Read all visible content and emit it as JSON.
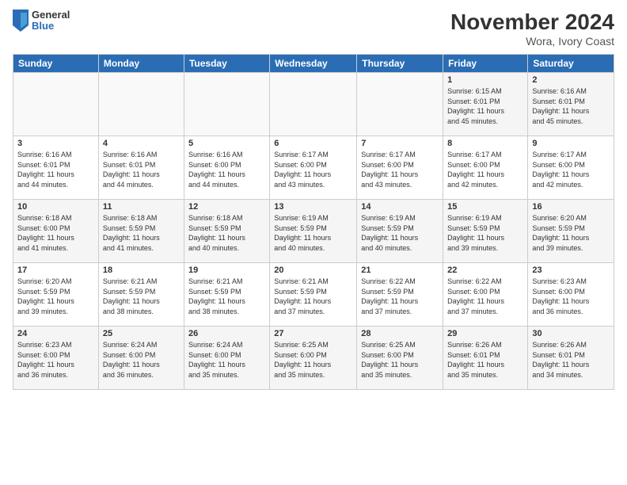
{
  "logo": {
    "general": "General",
    "blue": "Blue"
  },
  "title": "November 2024",
  "subtitle": "Wora, Ivory Coast",
  "days_of_week": [
    "Sunday",
    "Monday",
    "Tuesday",
    "Wednesday",
    "Thursday",
    "Friday",
    "Saturday"
  ],
  "weeks": [
    [
      {
        "day": "",
        "info": ""
      },
      {
        "day": "",
        "info": ""
      },
      {
        "day": "",
        "info": ""
      },
      {
        "day": "",
        "info": ""
      },
      {
        "day": "",
        "info": ""
      },
      {
        "day": "1",
        "info": "Sunrise: 6:15 AM\nSunset: 6:01 PM\nDaylight: 11 hours\nand 45 minutes."
      },
      {
        "day": "2",
        "info": "Sunrise: 6:16 AM\nSunset: 6:01 PM\nDaylight: 11 hours\nand 45 minutes."
      }
    ],
    [
      {
        "day": "3",
        "info": "Sunrise: 6:16 AM\nSunset: 6:01 PM\nDaylight: 11 hours\nand 44 minutes."
      },
      {
        "day": "4",
        "info": "Sunrise: 6:16 AM\nSunset: 6:01 PM\nDaylight: 11 hours\nand 44 minutes."
      },
      {
        "day": "5",
        "info": "Sunrise: 6:16 AM\nSunset: 6:00 PM\nDaylight: 11 hours\nand 44 minutes."
      },
      {
        "day": "6",
        "info": "Sunrise: 6:17 AM\nSunset: 6:00 PM\nDaylight: 11 hours\nand 43 minutes."
      },
      {
        "day": "7",
        "info": "Sunrise: 6:17 AM\nSunset: 6:00 PM\nDaylight: 11 hours\nand 43 minutes."
      },
      {
        "day": "8",
        "info": "Sunrise: 6:17 AM\nSunset: 6:00 PM\nDaylight: 11 hours\nand 42 minutes."
      },
      {
        "day": "9",
        "info": "Sunrise: 6:17 AM\nSunset: 6:00 PM\nDaylight: 11 hours\nand 42 minutes."
      }
    ],
    [
      {
        "day": "10",
        "info": "Sunrise: 6:18 AM\nSunset: 6:00 PM\nDaylight: 11 hours\nand 41 minutes."
      },
      {
        "day": "11",
        "info": "Sunrise: 6:18 AM\nSunset: 5:59 PM\nDaylight: 11 hours\nand 41 minutes."
      },
      {
        "day": "12",
        "info": "Sunrise: 6:18 AM\nSunset: 5:59 PM\nDaylight: 11 hours\nand 40 minutes."
      },
      {
        "day": "13",
        "info": "Sunrise: 6:19 AM\nSunset: 5:59 PM\nDaylight: 11 hours\nand 40 minutes."
      },
      {
        "day": "14",
        "info": "Sunrise: 6:19 AM\nSunset: 5:59 PM\nDaylight: 11 hours\nand 40 minutes."
      },
      {
        "day": "15",
        "info": "Sunrise: 6:19 AM\nSunset: 5:59 PM\nDaylight: 11 hours\nand 39 minutes."
      },
      {
        "day": "16",
        "info": "Sunrise: 6:20 AM\nSunset: 5:59 PM\nDaylight: 11 hours\nand 39 minutes."
      }
    ],
    [
      {
        "day": "17",
        "info": "Sunrise: 6:20 AM\nSunset: 5:59 PM\nDaylight: 11 hours\nand 39 minutes."
      },
      {
        "day": "18",
        "info": "Sunrise: 6:21 AM\nSunset: 5:59 PM\nDaylight: 11 hours\nand 38 minutes."
      },
      {
        "day": "19",
        "info": "Sunrise: 6:21 AM\nSunset: 5:59 PM\nDaylight: 11 hours\nand 38 minutes."
      },
      {
        "day": "20",
        "info": "Sunrise: 6:21 AM\nSunset: 5:59 PM\nDaylight: 11 hours\nand 37 minutes."
      },
      {
        "day": "21",
        "info": "Sunrise: 6:22 AM\nSunset: 5:59 PM\nDaylight: 11 hours\nand 37 minutes."
      },
      {
        "day": "22",
        "info": "Sunrise: 6:22 AM\nSunset: 6:00 PM\nDaylight: 11 hours\nand 37 minutes."
      },
      {
        "day": "23",
        "info": "Sunrise: 6:23 AM\nSunset: 6:00 PM\nDaylight: 11 hours\nand 36 minutes."
      }
    ],
    [
      {
        "day": "24",
        "info": "Sunrise: 6:23 AM\nSunset: 6:00 PM\nDaylight: 11 hours\nand 36 minutes."
      },
      {
        "day": "25",
        "info": "Sunrise: 6:24 AM\nSunset: 6:00 PM\nDaylight: 11 hours\nand 36 minutes."
      },
      {
        "day": "26",
        "info": "Sunrise: 6:24 AM\nSunset: 6:00 PM\nDaylight: 11 hours\nand 35 minutes."
      },
      {
        "day": "27",
        "info": "Sunrise: 6:25 AM\nSunset: 6:00 PM\nDaylight: 11 hours\nand 35 minutes."
      },
      {
        "day": "28",
        "info": "Sunrise: 6:25 AM\nSunset: 6:00 PM\nDaylight: 11 hours\nand 35 minutes."
      },
      {
        "day": "29",
        "info": "Sunrise: 6:26 AM\nSunset: 6:01 PM\nDaylight: 11 hours\nand 35 minutes."
      },
      {
        "day": "30",
        "info": "Sunrise: 6:26 AM\nSunset: 6:01 PM\nDaylight: 11 hours\nand 34 minutes."
      }
    ]
  ]
}
